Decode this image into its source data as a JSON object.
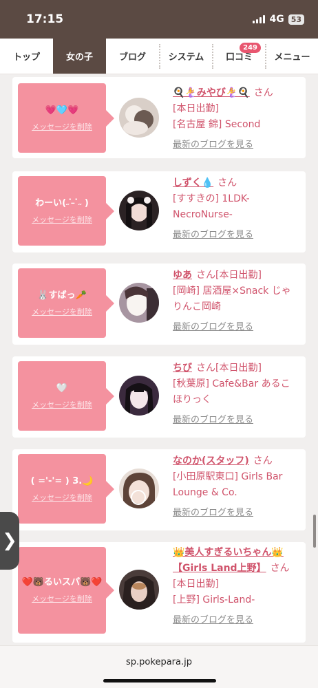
{
  "status_bar": {
    "time": "17:15",
    "network": "4G",
    "battery": "53"
  },
  "nav": {
    "tabs": [
      {
        "label": "トップ"
      },
      {
        "label": "女の子"
      },
      {
        "label": "ブログ"
      },
      {
        "label": "システム"
      },
      {
        "label": "口コミ",
        "badge": "249"
      },
      {
        "label": "メニュー"
      }
    ]
  },
  "entries": [
    {
      "message": "💗🩵💗",
      "delete_label": "メッセージを削除",
      "name": "🍳🧜‍♀️みやび🧜‍♀️🍳",
      "suffix": "さん",
      "line1": "[本日出勤]",
      "line2": "[名古屋 錦] Second",
      "blog_link": "最新のブログを見る"
    },
    {
      "message": "わーい(˶ ̇ ̵ ̇˶ )",
      "delete_label": "メッセージを削除",
      "name": "しずく💧",
      "suffix": "さん",
      "line1": "[すすきの] 1LDK-",
      "line2": "NecroNurse-",
      "blog_link": "最新のブログを見る"
    },
    {
      "message": "🐰すばっ🥕",
      "delete_label": "メッセージを削除",
      "name": "ゆあ",
      "suffix": "さん[本日出勤]",
      "line1": "[岡崎] 居酒屋×Snack じゃ",
      "line2": "りんこ岡崎",
      "blog_link": "最新のブログを見る"
    },
    {
      "message": "🤍",
      "delete_label": "メッセージを削除",
      "name": "ちび",
      "suffix": "さん[本日出勤]",
      "line1": "[秋葉原] Cafe&Bar あるこ",
      "line2": "ほりっく",
      "blog_link": "最新のブログを見る"
    },
    {
      "message": "( ='-'= ) 3.🌙",
      "delete_label": "メッセージを削除",
      "name": "なのか(スタッフ)",
      "suffix": "さん",
      "line1": "[小田原駅東口] Girls Bar",
      "line2": "Lounge & Co.",
      "blog_link": "最新のブログを見る"
    },
    {
      "message": "❤️🐻るいスパ🐻❤️",
      "delete_label": "メッセージを削除",
      "name": "👑美人すぎるいちゃん👑",
      "name2": "【Girls Land上野】",
      "suffix": "さん",
      "line1": "[本日出勤]",
      "line2": "[上野] Girls-Land-",
      "blog_link": "最新のブログを見る"
    }
  ],
  "bottom": {
    "url": "sp.pokepara.jp"
  },
  "handle_glyph": "❯"
}
